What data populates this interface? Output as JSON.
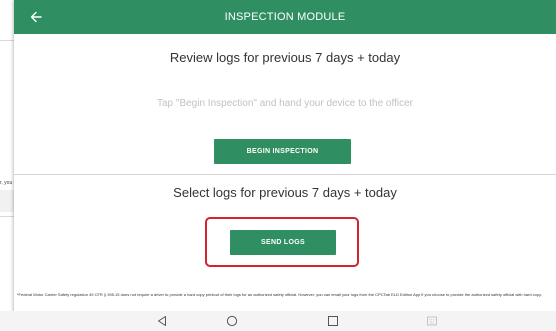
{
  "background": {
    "clipped_text": "r, you c"
  },
  "header": {
    "title": "INSPECTION MODULE",
    "back_icon": "arrow-left-icon"
  },
  "review": {
    "title": "Review logs for previous 7 days + today",
    "hint": "Tap \"Begin Inspection\" and hand your device to the officer",
    "button_label": "BEGIN INSPECTION"
  },
  "send": {
    "title": "Select logs for previous 7 days + today",
    "button_label": "SEND LOGS"
  },
  "footnote": "*Federal Motor Carrier Safety regulation 49 CFR § 395.15 does not require a driver to provide a hard copy printout of their logs for an authorized safety official. However, you can email your logs from the CPCTab ELD Edition App if you choose to provide the authorized safety official with hard copy.",
  "navbar": {
    "icons": [
      "back-triangle-icon",
      "home-circle-icon",
      "recents-square-icon",
      "keyboard-icon"
    ]
  },
  "colors": {
    "brand_green": "#2f8f63",
    "highlight_red": "#d1242f"
  }
}
